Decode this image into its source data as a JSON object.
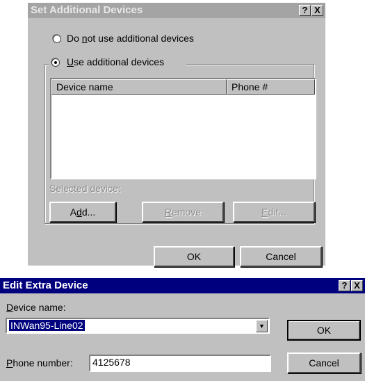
{
  "dialog1": {
    "title": "Set Additional Devices",
    "help_label": "?",
    "close_label": "X",
    "radio_no_prefix": "Do ",
    "radio_no_hotkey": "n",
    "radio_no_suffix": "ot use additional devices",
    "radio_use_prefix": "",
    "radio_use_hotkey": "U",
    "radio_use_suffix": "se additional devices",
    "radio_selected": "use",
    "columns": [
      "Device name",
      "Phone #"
    ],
    "rows": [],
    "selected_device_label": "Selected device:",
    "add_prefix": "A",
    "add_hotkey": "d",
    "add_suffix": "d...",
    "remove_hotkey": "R",
    "remove_suffix": "emove",
    "edit_hotkey": "E",
    "edit_suffix": "dit...",
    "ok_label": "OK",
    "cancel_label": "Cancel"
  },
  "dialog2": {
    "title": "Edit Extra Device",
    "help_label": "?",
    "close_label": "X",
    "device_name_hotkey": "D",
    "device_name_suffix": "evice name:",
    "device_name_value": "INWan95-Line02",
    "phone_hotkey": "P",
    "phone_suffix": "hone number:",
    "phone_value": "4125678",
    "ok_label": "OK",
    "cancel_label": "Cancel"
  },
  "colors": {
    "face": "#c0c0c0",
    "active_title": "#00007e",
    "inactive_title": "#a4a4a4"
  }
}
